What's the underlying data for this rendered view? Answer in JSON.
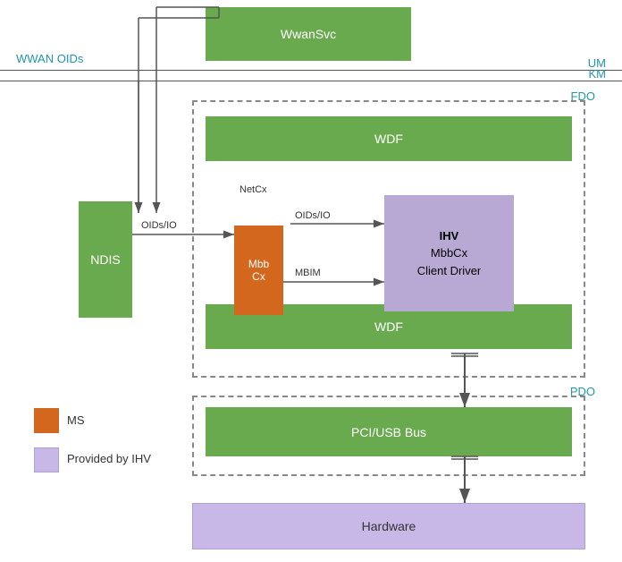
{
  "labels": {
    "wwan_oids": "WWAN OIDs",
    "um": "UM",
    "km": "KM",
    "fdo": "FDO",
    "pdo": "PDO",
    "wwansvc": "WwanSvc",
    "wdf_top": "WDF",
    "wdf_bottom": "WDF",
    "ndis": "NDIS",
    "mbbcx": "Mbb\nCx",
    "ihv": "IHV\nMbbCx\nClient Driver",
    "pcibus": "PCI/USB Bus",
    "hardware": "Hardware",
    "legend_ms": "MS",
    "legend_ihv": "Provided by IHV",
    "netcx": "NetCx",
    "oids_io_top": "OIDs/IO",
    "oids_io_bottom": "OIDs/IO",
    "mbim": "MBIM"
  },
  "colors": {
    "green": "#6aaa4e",
    "orange": "#d4671e",
    "purple_light": "#c8b8e8",
    "purple_mid": "#b8a8d4",
    "blue_label": "#2196a8",
    "white": "#ffffff",
    "dark": "#333333"
  }
}
